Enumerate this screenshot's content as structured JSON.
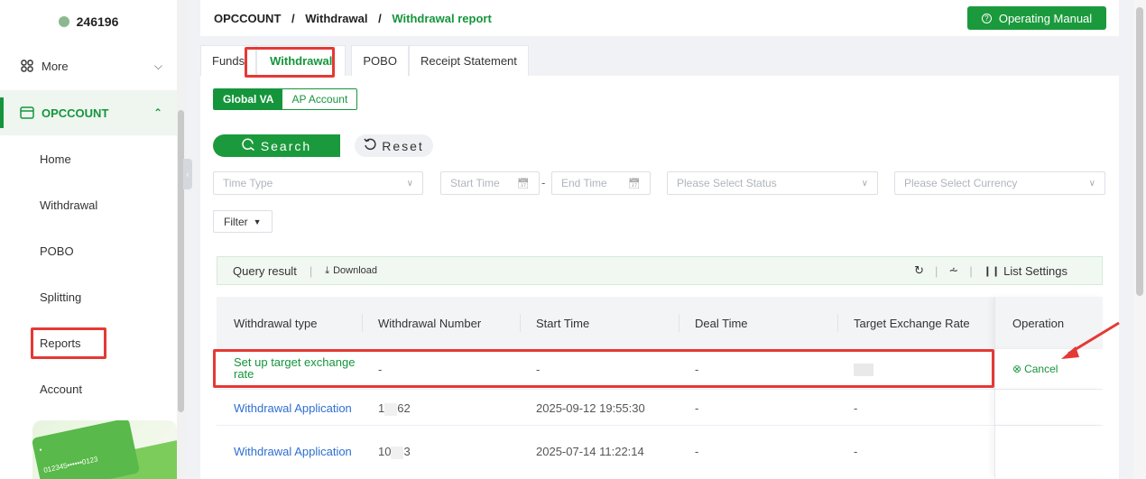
{
  "sidebar": {
    "user_id": "246196",
    "more_label": "More",
    "section_label": "OPCCOUNT",
    "items": [
      {
        "label": "Home"
      },
      {
        "label": "Withdrawal"
      },
      {
        "label": "POBO"
      },
      {
        "label": "Splitting"
      },
      {
        "label": "Reports"
      },
      {
        "label": "Account"
      }
    ],
    "card_text": "012345••••••0123"
  },
  "header": {
    "breadcrumb": [
      "OPCCOUNT",
      "Withdrawal",
      "Withdrawal report"
    ],
    "breadcrumb_sep": "/",
    "manual_label": "Operating Manual"
  },
  "tabs": [
    {
      "label": "Funds"
    },
    {
      "label": "Withdrawal"
    },
    {
      "label": "POBO"
    },
    {
      "label": "Receipt Statement"
    }
  ],
  "segments": [
    {
      "label": "Global VA"
    },
    {
      "label": "AP Account"
    }
  ],
  "actions": {
    "search_label": "Search",
    "reset_label": "Reset",
    "filter_label": "Filter"
  },
  "filters": {
    "time_type_placeholder": "Time Type",
    "start_time_placeholder": "Start Time",
    "end_time_placeholder": "End Time",
    "status_placeholder": "Please Select Status",
    "currency_placeholder": "Please Select Currency",
    "range_sep": "-"
  },
  "toolbar": {
    "query_result": "Query result",
    "download_label": "Download",
    "list_settings_label": "List Settings"
  },
  "table": {
    "columns": [
      "Withdrawal type",
      "Withdrawal Number",
      "Start Time",
      "Deal Time",
      "Target Exchange Rate",
      "Operation"
    ],
    "rows": [
      {
        "type": "Set up target exchange rate",
        "number": "-",
        "start": "-",
        "deal": "-",
        "rate": "",
        "op": "Cancel"
      },
      {
        "type": "Withdrawal Application",
        "number_prefix": "1",
        "number_suffix": "62",
        "start": "2025-09-12 19:55:30",
        "deal": "-",
        "rate": "-",
        "op": ""
      },
      {
        "type": "Withdrawal Application",
        "number_prefix": "10",
        "number_suffix": "3",
        "start": "2025-07-14 11:22:14",
        "deal": "-",
        "rate": "-",
        "op": ""
      }
    ]
  },
  "colors": {
    "brand_green": "#15953b",
    "link_blue": "#2e6fd0",
    "annotation_red": "#e53935"
  }
}
